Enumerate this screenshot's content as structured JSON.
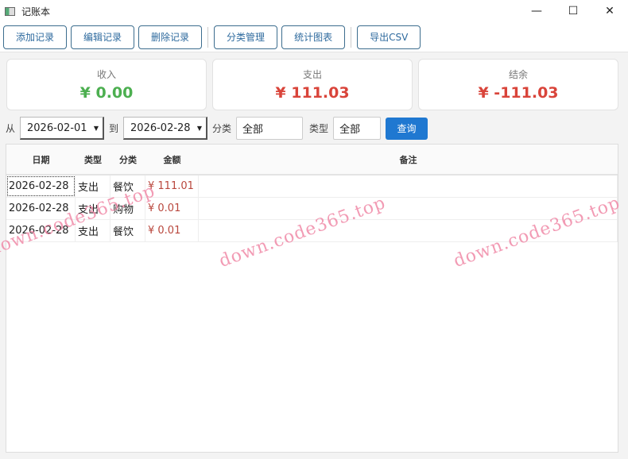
{
  "window": {
    "title": "记账本",
    "minimize": "—",
    "maximize": "☐",
    "close": "✕"
  },
  "toolbar": {
    "add": "添加记录",
    "edit": "编辑记录",
    "delete": "删除记录",
    "categories": "分类管理",
    "stats": "统计图表",
    "export": "导出CSV"
  },
  "summary": [
    {
      "label": "收入",
      "value": "¥ 0.00",
      "color": "#4caf50"
    },
    {
      "label": "支出",
      "value": "¥ 111.03",
      "color": "#d9443a"
    },
    {
      "label": "结余",
      "value": "¥ -111.03",
      "color": "#d9443a"
    }
  ],
  "filters": {
    "from_label": "从",
    "from": "2026-02-01",
    "to_label": "到",
    "to": "2026-02-28",
    "category_label": "分类",
    "category": "全部",
    "type_label": "类型",
    "type": "全部",
    "query": "查询"
  },
  "table": {
    "headers": [
      "日期",
      "类型",
      "分类",
      "金额",
      "备注"
    ],
    "rows": [
      [
        "2026-02-28",
        "支出",
        "餐饮",
        "¥ 111.01",
        ""
      ],
      [
        "2026-02-28",
        "支出",
        "购物",
        "¥ 0.01",
        ""
      ],
      [
        "2026-02-28",
        "支出",
        "餐饮",
        "¥ 0.01",
        ""
      ]
    ]
  },
  "watermark": "down.code365.top"
}
